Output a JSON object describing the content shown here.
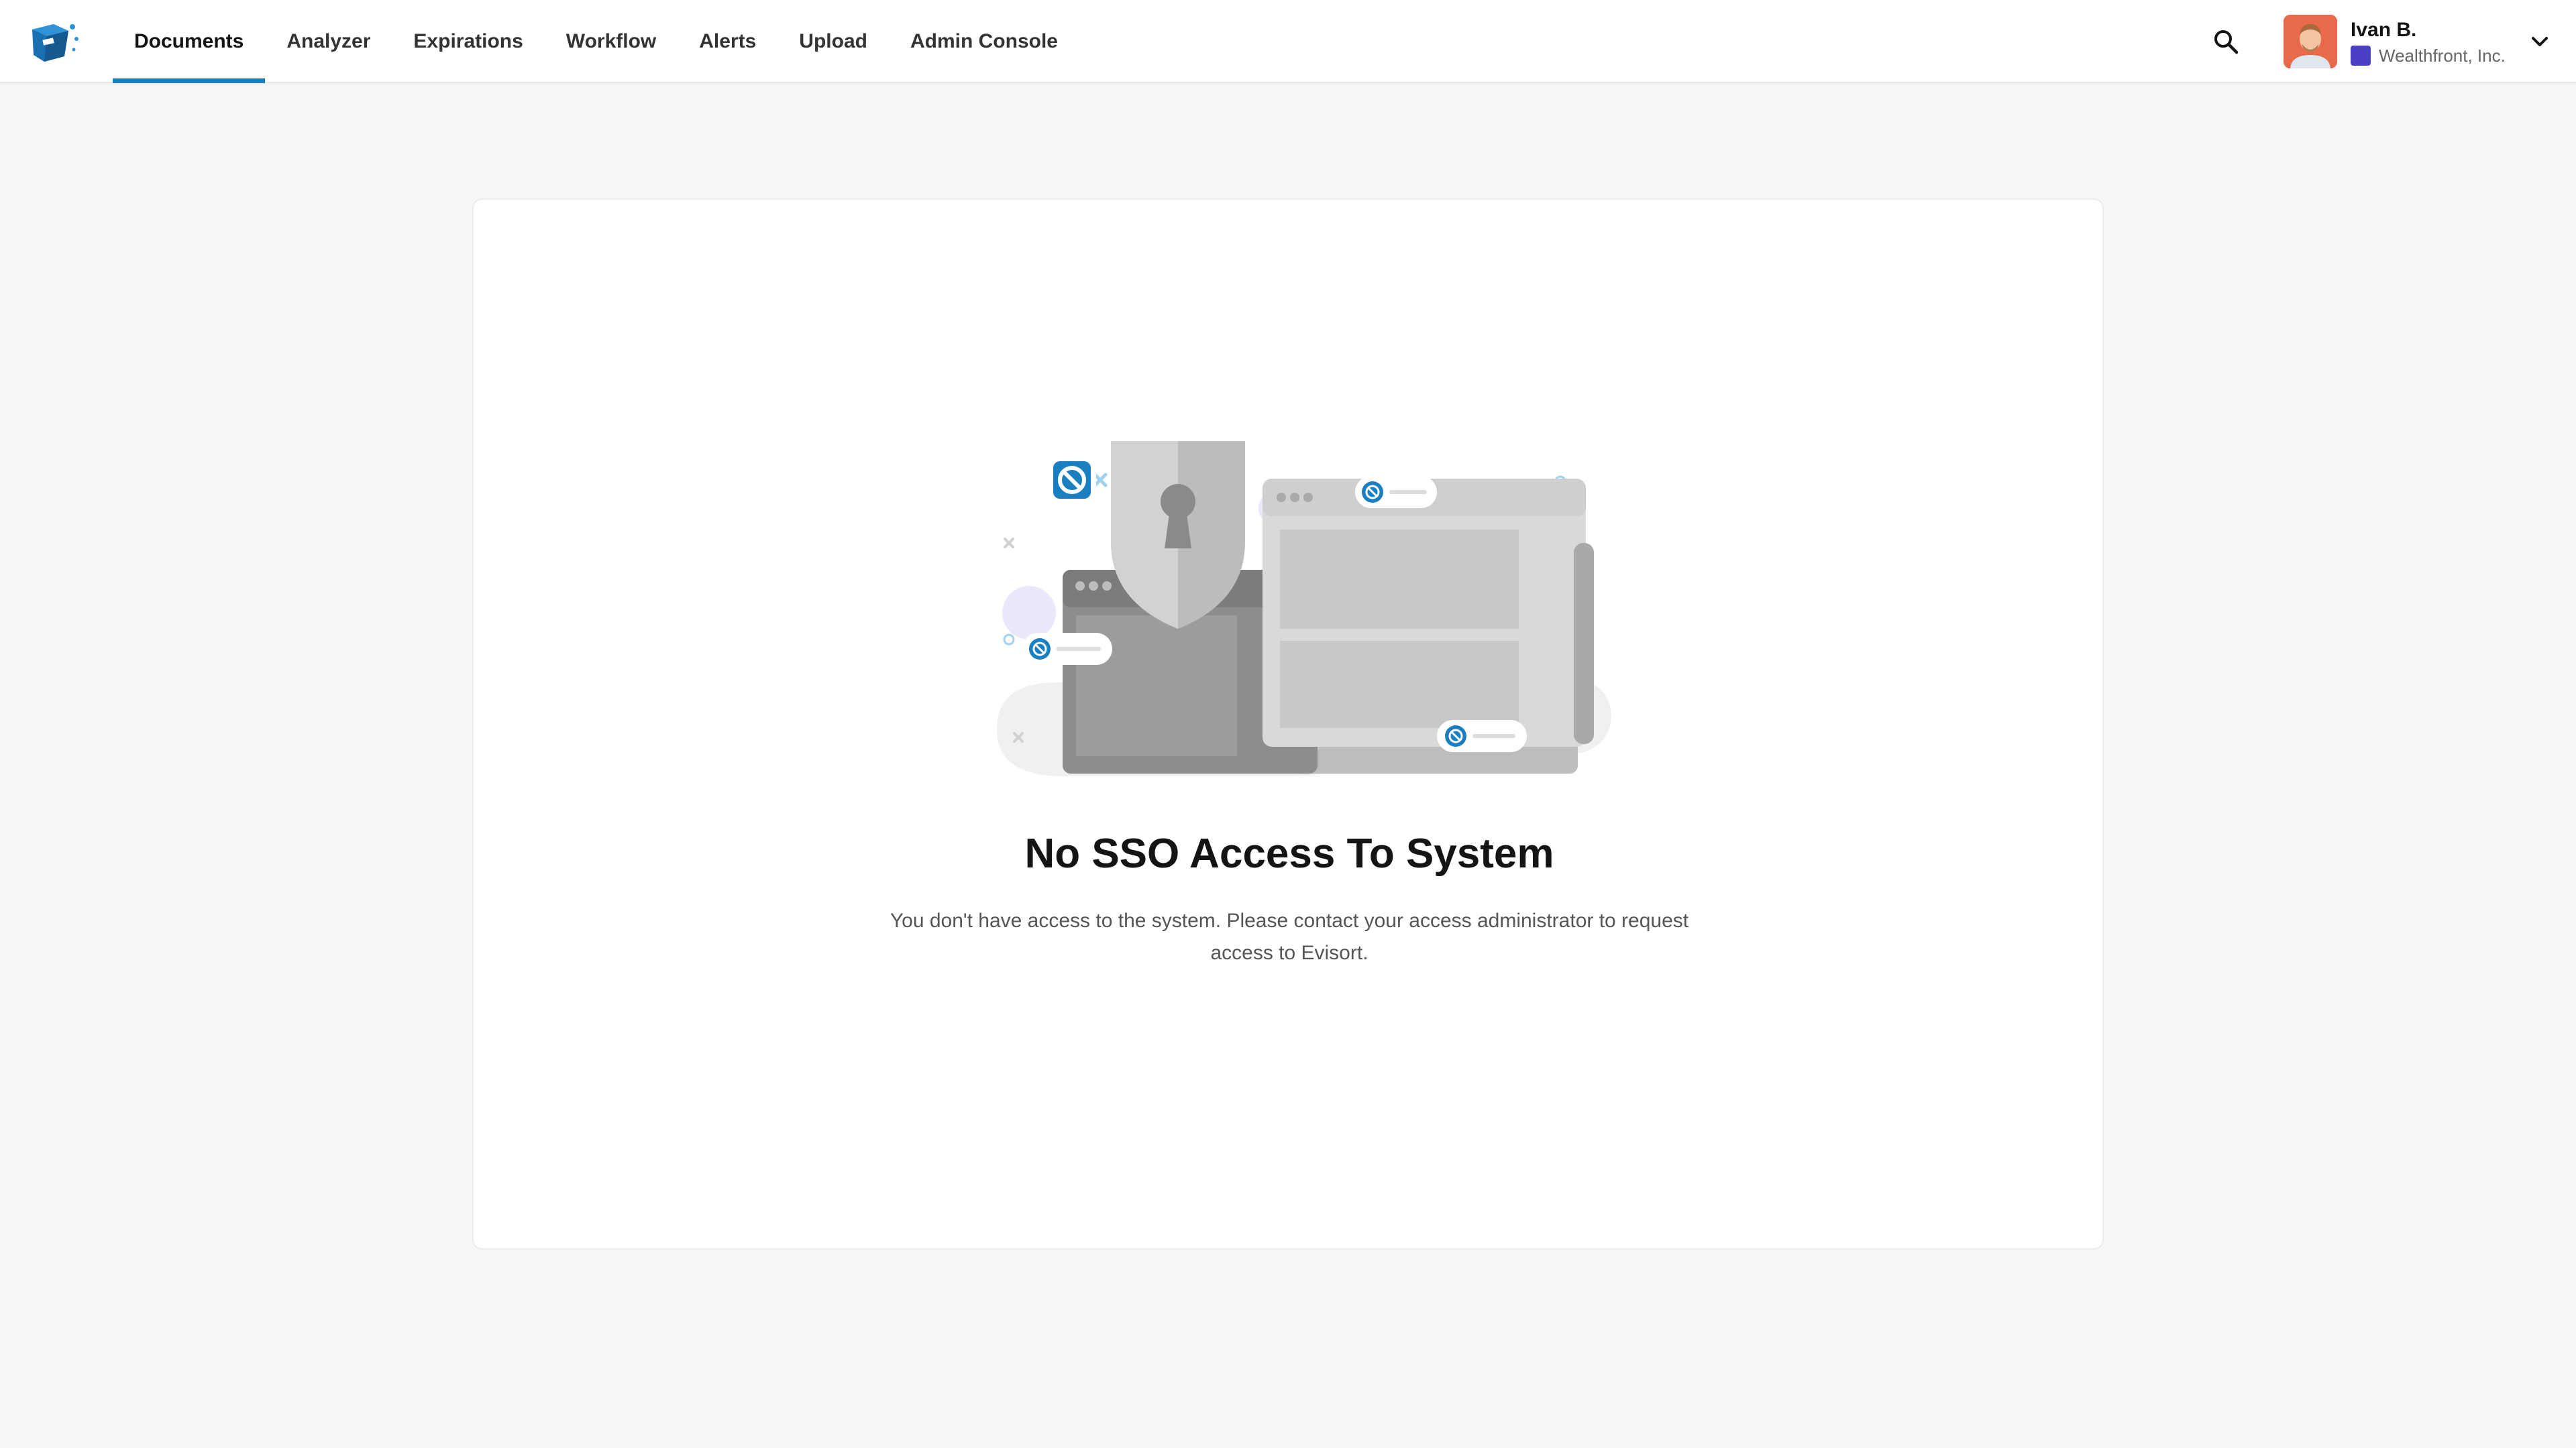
{
  "app": {
    "brand_color": "#1a7fc1",
    "logo_icon": "evisort-logo-icon"
  },
  "nav": {
    "items": [
      {
        "label": "Documents",
        "active": true
      },
      {
        "label": "Analyzer",
        "active": false
      },
      {
        "label": "Expirations",
        "active": false
      },
      {
        "label": "Workflow",
        "active": false
      },
      {
        "label": "Alerts",
        "active": false
      },
      {
        "label": "Upload",
        "active": false
      },
      {
        "label": "Admin Console",
        "active": false
      }
    ]
  },
  "header": {
    "search_icon": "search-icon",
    "user": {
      "name": "Ivan B.",
      "organization": "Wealthfront, Inc.",
      "org_color": "#4b3fc4",
      "menu_icon": "chevron-down-icon"
    }
  },
  "main": {
    "title": "No SSO Access To System",
    "message": "You don't have access to the system. Please contact your access administrator to request access to Evisort.",
    "illustration_icon": "locked-shield-illustration"
  }
}
